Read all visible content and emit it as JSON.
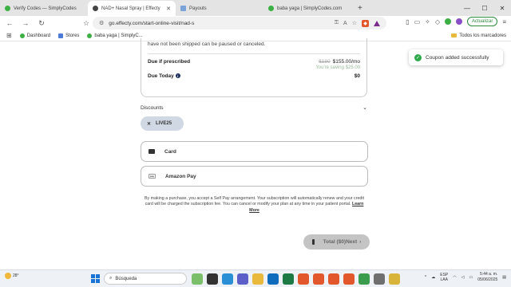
{
  "browser": {
    "tabs": [
      {
        "title": "Verify Codes — SimplyCodes",
        "color": "#3cb043"
      },
      {
        "title": "NAD+ Nasal Spray | Effecty",
        "color": "#444444",
        "active": true
      },
      {
        "title": "Payouts",
        "color": "#7aa3d8"
      },
      {
        "title": "baba yaga | SimplyCodes.com",
        "color": "#3cb043"
      }
    ],
    "url": "go.effecty.com/start-online-visit/nad-s",
    "update_label": "Actualizar",
    "bookmarks": [
      {
        "label": "Dashboard",
        "color": "#3cb043"
      },
      {
        "label": "Stores",
        "color": "#4b7bd6"
      },
      {
        "label": "baba yaga | SimplyC...",
        "color": "#3cb043"
      }
    ],
    "all_bookmarks": "Todos los marcadores"
  },
  "checkout": {
    "note": "have not been shipped can be paused or canceled.",
    "due_if_prescribed_label": "Due if prescribed",
    "old_price": "$180",
    "new_price": "$155.00/mo",
    "saving": "You're saving $25.00",
    "due_today_label": "Due Today",
    "due_today_value": "$0",
    "discounts_label": "Discounts",
    "coupon_code": "LIVE25",
    "payment_options": [
      "Card",
      "Amazon Pay"
    ],
    "legal_text": "By making a purchase, you accept a Self Pay arrangement. Your subscription will automatically renew and your credit card will be charged the subscription fee. You can cancel or modify your plan at any time in your patient portal.",
    "learn_more": "Learn More",
    "next_button": "Total ($0)Next"
  },
  "toast": {
    "message": "Coupon added successfully"
  },
  "taskbar": {
    "temperature": "28°",
    "search_placeholder": "Búsqueda",
    "lang_top": "ESP",
    "lang_bottom": "LAA",
    "time": "5:44 a. m.",
    "date": "05/06/2025"
  }
}
